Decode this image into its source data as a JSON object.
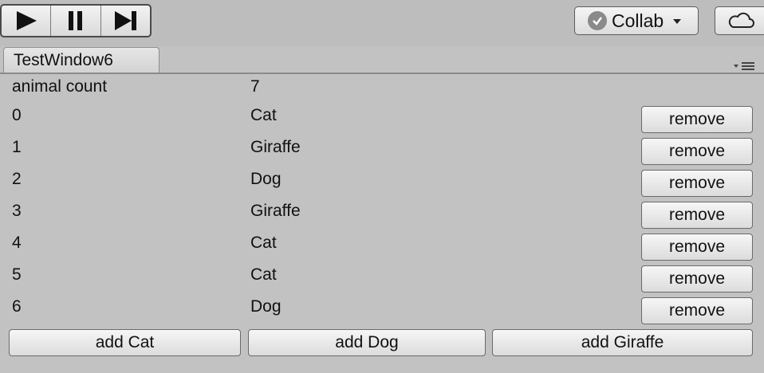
{
  "toolbar": {
    "play_icon": "play-icon",
    "pause_icon": "pause-icon",
    "step_icon": "step-icon",
    "collab_label": "Collab",
    "collab_icon": "check-circle-icon",
    "cloud_icon": "cloud-icon"
  },
  "tab": {
    "title": "TestWindow6",
    "menu_icon": "tab-menu-icon"
  },
  "summary": {
    "label": "animal count",
    "value": "7"
  },
  "animals": [
    {
      "index": "0",
      "name": "Cat",
      "action": "remove"
    },
    {
      "index": "1",
      "name": "Giraffe",
      "action": "remove"
    },
    {
      "index": "2",
      "name": "Dog",
      "action": "remove"
    },
    {
      "index": "3",
      "name": "Giraffe",
      "action": "remove"
    },
    {
      "index": "4",
      "name": "Cat",
      "action": "remove"
    },
    {
      "index": "5",
      "name": "Cat",
      "action": "remove"
    },
    {
      "index": "6",
      "name": "Dog",
      "action": "remove"
    }
  ],
  "actions": {
    "add_cat": "add Cat",
    "add_dog": "add Dog",
    "add_giraffe": "add Giraffe"
  },
  "colors": {
    "background": "#c2c2c2",
    "button_top": "#f6f6f6",
    "button_bottom": "#dcdcdc",
    "border": "#6a6a6a"
  }
}
